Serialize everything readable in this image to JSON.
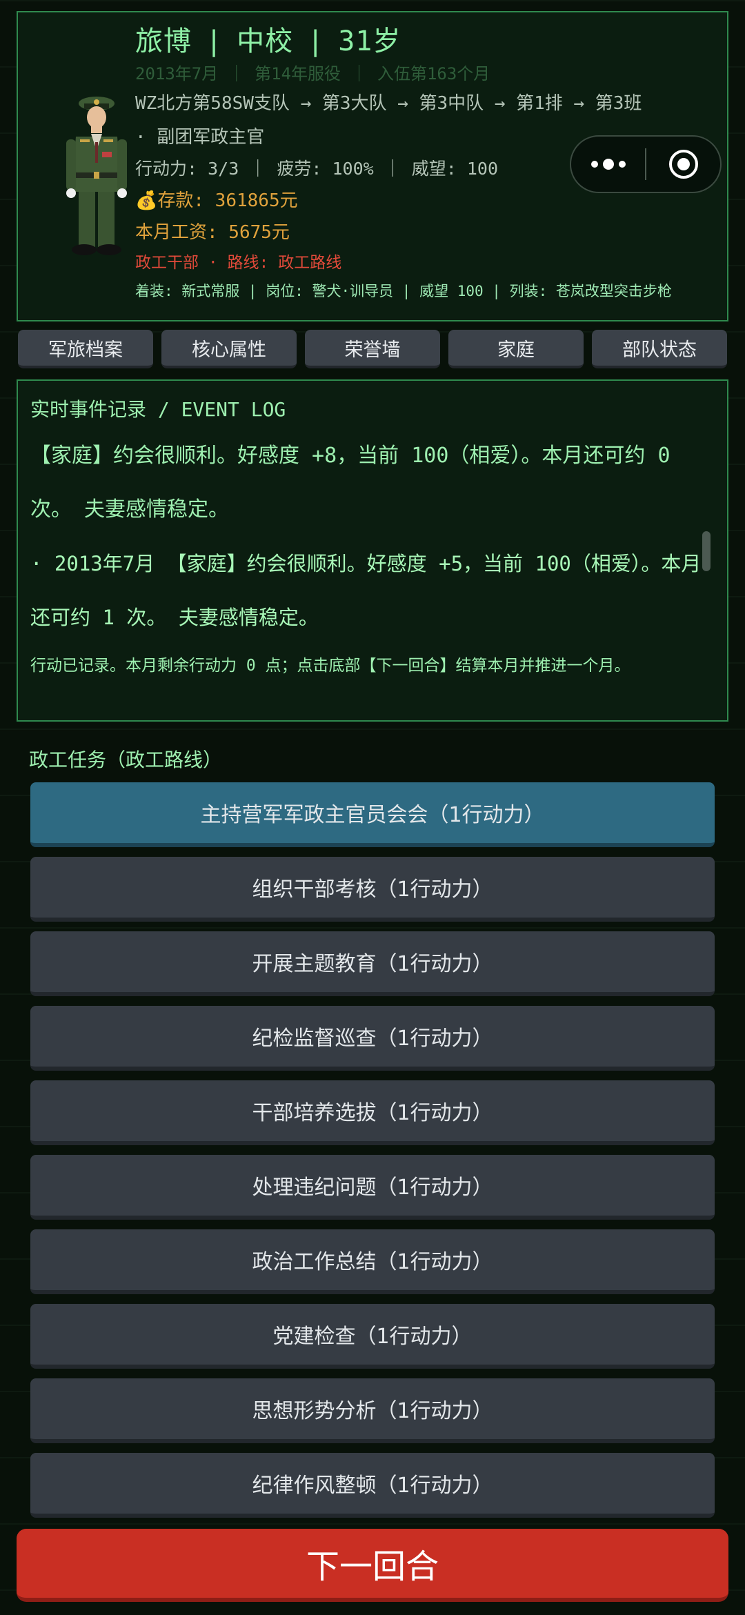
{
  "colors": {
    "panel_border": "#2f8a4e",
    "panel_bg": "#0b1d10",
    "text_green": "#9ef0b0",
    "text_gold": "#e0a23c",
    "text_red": "#e24a3a",
    "tab_bg": "#3b4149",
    "task_bg": "#363c44",
    "task_active_bg": "#2e6a82",
    "next_button_bg": "#c92f23"
  },
  "profile": {
    "name": "旅博",
    "rank": "中校",
    "age": "31岁",
    "separator": "|",
    "date_line": "2013年7月 ｜ 第14年服役 ｜ 入伍第163个月",
    "unit_path": "WZ北方第58SW支队 → 第3大队 → 第3中队 → 第1排 → 第3班",
    "post": "· 副团军政主官",
    "stats": "行动力: 3/3 ｜ 疲劳: 100% ｜ 威望: 100",
    "money_icon": "money-bag-icon",
    "money": "💰存款: 361865元",
    "salary": "本月工资: 5675元",
    "route": "政工干部 · 路线: 政工路线",
    "equipment": "着装: 新式常服 | 岗位: 警犬·训导员 | 威望 100 | 列装: 苍岚改型突击步枪"
  },
  "capsule": {
    "more_icon": "more-dots-icon",
    "close_icon": "target-close-icon"
  },
  "tabs": [
    {
      "label": "军旅档案"
    },
    {
      "label": "核心属性"
    },
    {
      "label": "荣誉墙"
    },
    {
      "label": "家庭"
    },
    {
      "label": "部队状态"
    }
  ],
  "event_log": {
    "title": "实时事件记录 / EVENT LOG",
    "entries": [
      "【家庭】约会很顺利。好感度 +8，当前 100（相爱）。本月还可约 0 次。 夫妻感情稳定。",
      "· 2013年7月 【家庭】约会很顺利。好感度 +5，当前 100（相爱）。本月还可约 1 次。 夫妻感情稳定。"
    ],
    "note": "行动已记录。本月剩余行动力 0 点；点击底部【下一回合】结算本月并推进一个月。"
  },
  "tasks_section": {
    "label": "政工任务（政工路线）",
    "items": [
      {
        "label": "主持营军军政主官员会会（1行动力）"
      },
      {
        "label": "组织干部考核（1行动力）"
      },
      {
        "label": "开展主题教育（1行动力）"
      },
      {
        "label": "纪检监督巡查（1行动力）"
      },
      {
        "label": "干部培养选拔（1行动力）"
      },
      {
        "label": "处理违纪问题（1行动力）"
      },
      {
        "label": "政治工作总结（1行动力）"
      },
      {
        "label": "党建检查（1行动力）"
      },
      {
        "label": "思想形势分析（1行动力）"
      },
      {
        "label": "纪律作风整顿（1行动力）"
      }
    ]
  },
  "next_button": {
    "label": "下一回合"
  }
}
